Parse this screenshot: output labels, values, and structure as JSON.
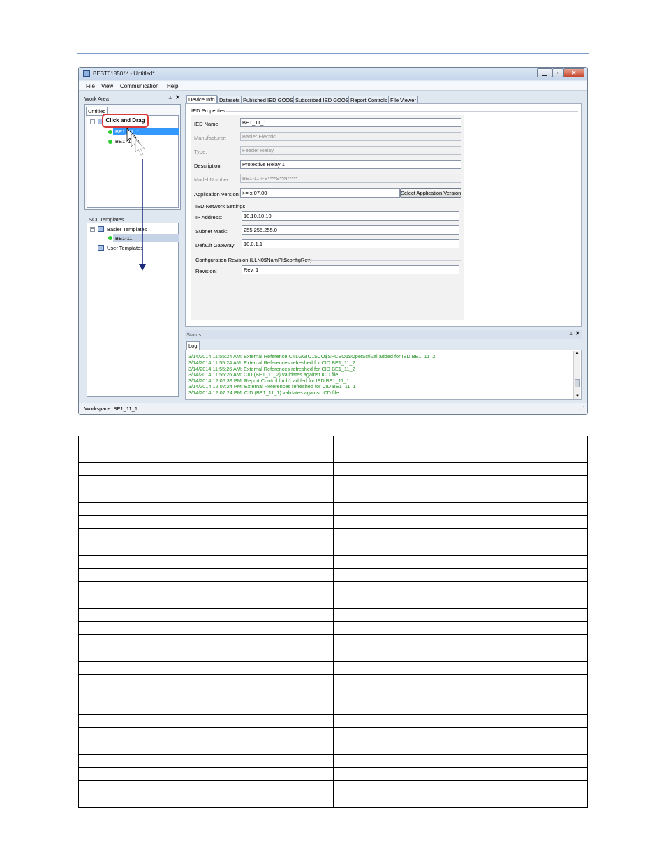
{
  "window": {
    "title": "BEST61850™ - Untitled*",
    "minimize_icon": "minimize-icon",
    "maximize_icon": "maximize-icon",
    "close_icon": "close-icon"
  },
  "menu": [
    "File",
    "View",
    "Communication",
    "Help"
  ],
  "work_area": {
    "title": "Work Area",
    "tab": "Untitled",
    "items": [
      "BE1_11_1",
      "BE1_11_2"
    ],
    "callout": "Click and Drag"
  },
  "scl_templates": {
    "title": "SCL Templates",
    "basler": "Basler Templates",
    "item": "BE1-11",
    "user": "User Templates"
  },
  "tabs": [
    "Device Info",
    "Datasets",
    "Published IED GOOSE",
    "Subscribed IED GOOSE",
    "Report Controls",
    "File Viewer"
  ],
  "ied_properties": {
    "title": "IED Properties",
    "ied_name_label": "IED Name:",
    "ied_name": "BE1_11_1",
    "manufacturer_label": "Manufacturer:",
    "manufacturer": "Basler Electric",
    "type_label": "Type:",
    "type": "Feeder Relay",
    "description_label": "Description:",
    "description": "Protective Relay 1",
    "model_label": "Model Number:",
    "model": "BE1-11-FS****S**N*****",
    "app_version_label": "Application Version:",
    "app_version": ">= x.07.00",
    "select_version_button": "Select Application Version"
  },
  "network": {
    "title": "IED Network Settings",
    "ip_label": "IP Address:",
    "ip": "10.10.10.10",
    "subnet_label": "Subnet Mask:",
    "subnet": "255.255.255.0",
    "gateway_label": "Default Gateway:",
    "gateway": "10.0.1.1"
  },
  "config_revision": {
    "title": "Configuration Revision (LLN0$NamPlt$configRev)",
    "revision_label": "Revision:",
    "revision": "Rev. 1"
  },
  "status": {
    "title": "Status",
    "tab": "Log",
    "log": [
      "3/14/2014 11:55:24 AM: External Reference CTLGGIO1$CO$SPCSO1$Oper$ctlVal added for IED BE1_11_2.",
      "3/14/2014 11:55:24 AM: External References refreshed for CID BE1_11_2.",
      "3/14/2014 11:55:26 AM: External References refreshed for CID BE1_11_2",
      "3/14/2014 11:55:26 AM: CID (BE1_11_2) validates against ICD file",
      "3/14/2014 12:05:39 PM: Report Control brcb1 added for IED BE1_11_1.",
      "3/14/2014 12:07:24 PM: External References refreshed for CID BE1_11_1",
      "3/14/2014 12:07:24 PM: CID (BE1_11_1) validates against ICD file"
    ]
  },
  "statusbar": {
    "workspace": "Workspace: BE1_11_1"
  },
  "table_rows": 28,
  "colors": {
    "log_text": "#1f8f1f",
    "callout_border": "#d83a3a",
    "arrow": "#1a2a7a",
    "selection": "#3399ff"
  }
}
